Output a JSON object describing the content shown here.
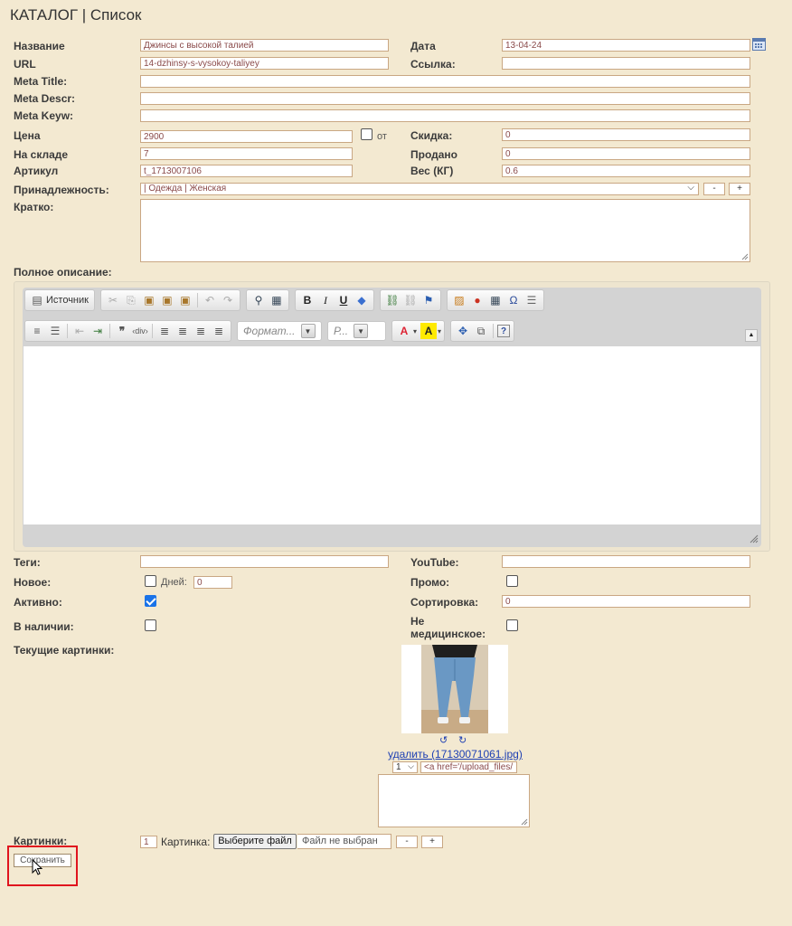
{
  "header": {
    "title": "КАТАЛОГ | Список"
  },
  "fields": {
    "name": {
      "label": "Название",
      "value": "Джинсы с высокой талией"
    },
    "date": {
      "label": "Дата",
      "value": "13-04-24"
    },
    "url": {
      "label": "URL",
      "value": "14-dzhinsy-s-vysokoy-taliyey"
    },
    "link": {
      "label": "Ссылка:",
      "value": ""
    },
    "meta_title": {
      "label": "Meta Title:",
      "value": ""
    },
    "meta_descr": {
      "label": "Meta Descr:",
      "value": ""
    },
    "meta_keyw": {
      "label": "Meta Keyw:",
      "value": ""
    },
    "price": {
      "label": "Цена",
      "value": "2900",
      "from_label": "от"
    },
    "discount": {
      "label": "Скидка:",
      "value": "0"
    },
    "stock": {
      "label": "На складе",
      "value": "7"
    },
    "sold": {
      "label": "Продано",
      "value": "0"
    },
    "article": {
      "label": "Артикул",
      "value": "t_1713007106"
    },
    "weight": {
      "label": "Вес (КГ)",
      "value": "0.6"
    },
    "belonging": {
      "label": "Принадлежность:",
      "value": "| Одежда | Женская",
      "minus": "-",
      "plus": "+"
    },
    "brief": {
      "label": "Кратко:"
    },
    "full": {
      "label": "Полное описание:"
    }
  },
  "editor": {
    "source_label": "Источник",
    "format_placeholder": "Формат...",
    "size_placeholder": "Р..."
  },
  "bottom": {
    "tags": {
      "label": "Теги:",
      "value": ""
    },
    "youtube": {
      "label": "YouTube:",
      "value": ""
    },
    "new": {
      "label": "Новое:",
      "checked": false,
      "days_label": "Дней:",
      "days_value": "0"
    },
    "promo": {
      "label": "Промо:",
      "checked": false
    },
    "active": {
      "label": "Активно:",
      "checked": true
    },
    "sort": {
      "label": "Сортировка:",
      "value": "0"
    },
    "in_stock": {
      "label": "В наличии:",
      "checked": false
    },
    "non_medical": {
      "label_line1": "Не",
      "label_line2": "медицинское:",
      "checked": false
    },
    "current_images": {
      "label": "Текущие картинки:"
    }
  },
  "image": {
    "rotate_left": "↺",
    "rotate_right": "↻",
    "delete_link": "удалить (17130071061.jpg)",
    "order_value": "1",
    "html_snippet": "<a href='/upload_files/"
  },
  "images_upload": {
    "label": "Картинки:",
    "count": "1",
    "picture_label": "Картинка:",
    "choose_button": "Выберите файл",
    "no_file": "Файл не выбран",
    "minus": "-",
    "plus": "+"
  },
  "save_label": "Сохранить",
  "colors": {
    "background": "#f3e9d1",
    "input_border": "#c9a783",
    "highlight": "#e0141e",
    "link": "#1d3fb3"
  }
}
